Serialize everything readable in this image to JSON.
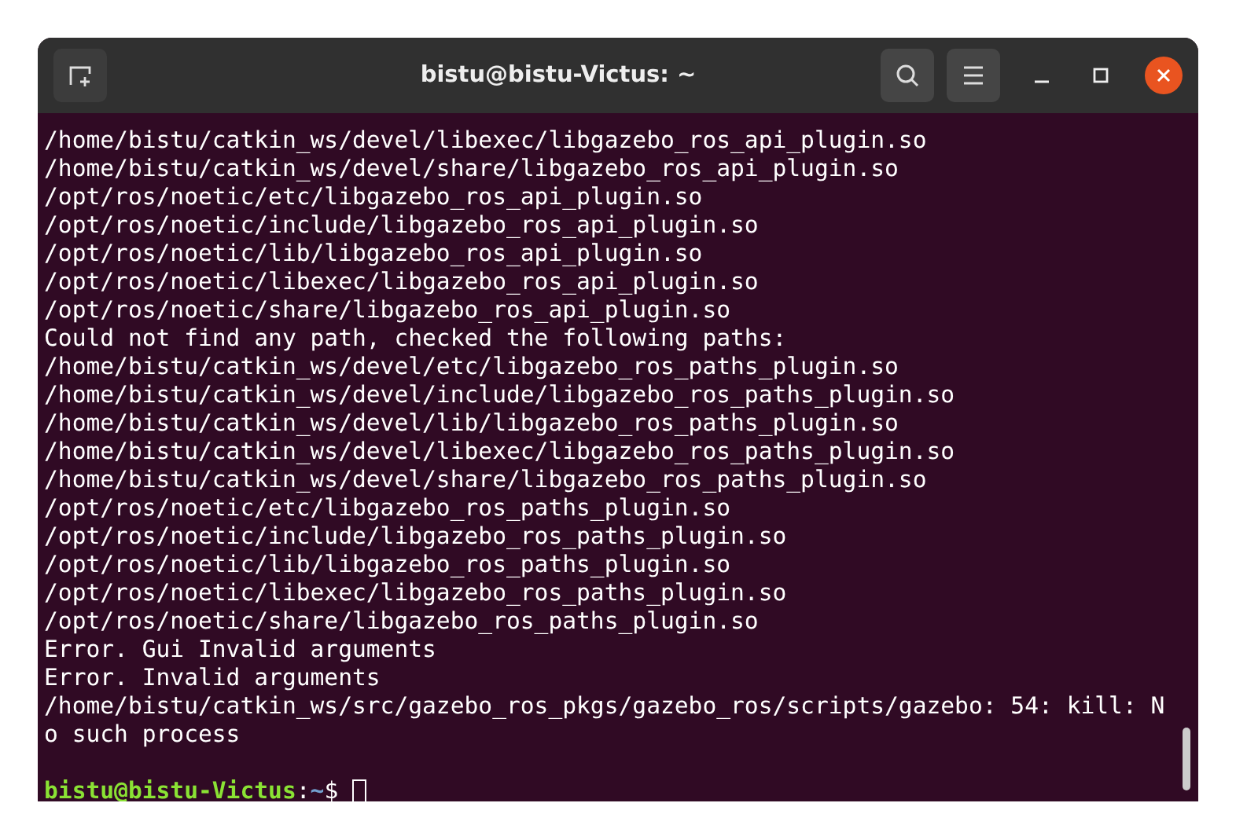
{
  "window": {
    "title": "bistu@bistu-Victus: ~"
  },
  "output_lines": [
    "/home/bistu/catkin_ws/devel/libexec/libgazebo_ros_api_plugin.so",
    "/home/bistu/catkin_ws/devel/share/libgazebo_ros_api_plugin.so",
    "/opt/ros/noetic/etc/libgazebo_ros_api_plugin.so",
    "/opt/ros/noetic/include/libgazebo_ros_api_plugin.so",
    "/opt/ros/noetic/lib/libgazebo_ros_api_plugin.so",
    "/opt/ros/noetic/libexec/libgazebo_ros_api_plugin.so",
    "/opt/ros/noetic/share/libgazebo_ros_api_plugin.so",
    "Could not find any path, checked the following paths:",
    "/home/bistu/catkin_ws/devel/etc/libgazebo_ros_paths_plugin.so",
    "/home/bistu/catkin_ws/devel/include/libgazebo_ros_paths_plugin.so",
    "/home/bistu/catkin_ws/devel/lib/libgazebo_ros_paths_plugin.so",
    "/home/bistu/catkin_ws/devel/libexec/libgazebo_ros_paths_plugin.so",
    "/home/bistu/catkin_ws/devel/share/libgazebo_ros_paths_plugin.so",
    "/opt/ros/noetic/etc/libgazebo_ros_paths_plugin.so",
    "/opt/ros/noetic/include/libgazebo_ros_paths_plugin.so",
    "/opt/ros/noetic/lib/libgazebo_ros_paths_plugin.so",
    "/opt/ros/noetic/libexec/libgazebo_ros_paths_plugin.so",
    "/opt/ros/noetic/share/libgazebo_ros_paths_plugin.so",
    "Error. Gui Invalid arguments",
    "Error. Invalid arguments",
    "/home/bistu/catkin_ws/src/gazebo_ros_pkgs/gazebo_ros/scripts/gazebo: 54: kill: N",
    "o such process"
  ],
  "prompt": {
    "user_host": "bistu@bistu-Victus",
    "separator": ":",
    "path": "~",
    "symbol": "$"
  }
}
